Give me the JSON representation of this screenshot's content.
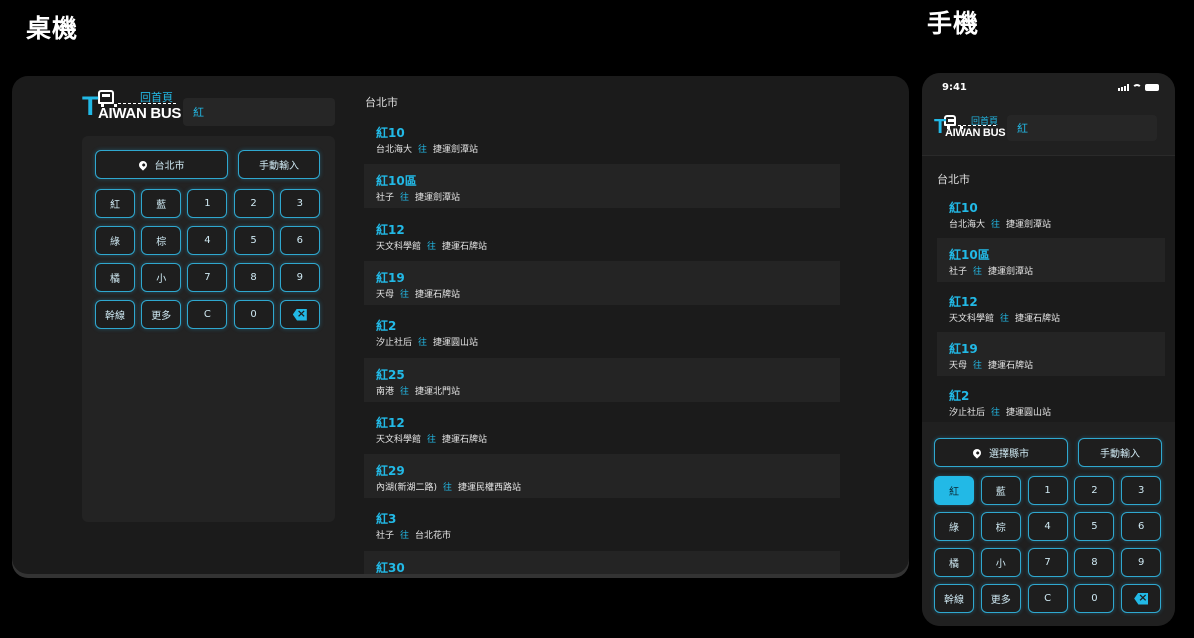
{
  "headings": {
    "desktop": "桌機",
    "mobile": "手機"
  },
  "logo": {
    "home": "回首頁",
    "t": "T",
    "rest": "AIWAN BUS"
  },
  "search": {
    "value": "紅"
  },
  "city_label": "台北市",
  "to_word": "往",
  "desktop": {
    "location_button": "台北市",
    "manual_button": "手動輸入"
  },
  "mobile": {
    "time": "9:41",
    "location_button": "選擇縣市",
    "manual_button": "手動輸入"
  },
  "keypad": [
    [
      "紅",
      "藍",
      "1",
      "2",
      "3"
    ],
    [
      "綠",
      "棕",
      "4",
      "5",
      "6"
    ],
    [
      "橘",
      "小",
      "7",
      "8",
      "9"
    ],
    [
      "幹線",
      "更多",
      "C",
      "0",
      "backspace"
    ]
  ],
  "routes": [
    {
      "name": "紅10",
      "from": "台北海大",
      "to": "捷運劍潭站"
    },
    {
      "name": "紅10區",
      "from": "社子",
      "to": "捷運劍潭站"
    },
    {
      "name": "紅12",
      "from": "天文科學館",
      "to": "捷運石牌站"
    },
    {
      "name": "紅19",
      "from": "天母",
      "to": "捷運石牌站"
    },
    {
      "name": "紅2",
      "from": "汐止社后",
      "to": "捷運圓山站"
    },
    {
      "name": "紅25",
      "from": "南港",
      "to": "捷運北門站"
    },
    {
      "name": "紅12",
      "from": "天文科學館",
      "to": "捷運石牌站"
    },
    {
      "name": "紅29",
      "from": "內湖(新湖二路)",
      "to": "捷運民權西路站"
    },
    {
      "name": "紅3",
      "from": "社子",
      "to": "台北花市"
    },
    {
      "name": "紅30",
      "from": "",
      "to": ""
    }
  ],
  "colors": {
    "accent": "#22b9e6",
    "panel": "#1b1b1b",
    "row_alt": "#242424"
  }
}
